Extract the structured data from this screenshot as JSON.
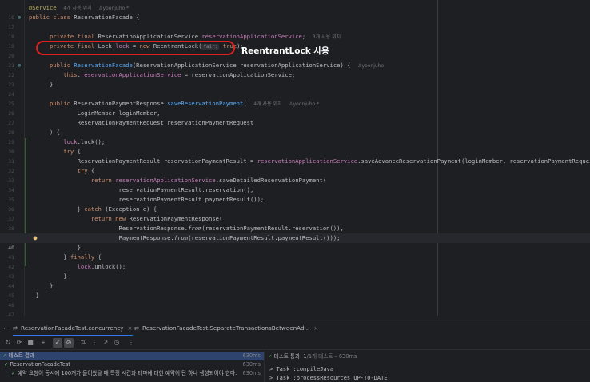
{
  "editor": {
    "annotation_label": "ReentrantLock 사용",
    "lines": [
      {
        "num": "16",
        "current": false
      },
      {
        "num": "17",
        "current": false
      },
      {
        "num": "18",
        "current": false
      },
      {
        "num": "19",
        "current": false
      },
      {
        "num": "20",
        "current": false
      },
      {
        "num": "21",
        "current": false
      },
      {
        "num": "22",
        "current": false
      },
      {
        "num": "23",
        "current": false
      },
      {
        "num": "24",
        "current": false
      },
      {
        "num": "25",
        "current": false
      },
      {
        "num": "26",
        "current": false
      },
      {
        "num": "27",
        "current": false
      },
      {
        "num": "28",
        "current": false
      },
      {
        "num": "29",
        "current": false
      },
      {
        "num": "30",
        "current": false
      },
      {
        "num": "31",
        "current": false
      },
      {
        "num": "32",
        "current": false
      },
      {
        "num": "33",
        "current": false
      },
      {
        "num": "34",
        "current": false
      },
      {
        "num": "35",
        "current": false
      },
      {
        "num": "36",
        "current": false
      },
      {
        "num": "37",
        "current": false
      },
      {
        "num": "38",
        "current": false
      },
      {
        "num": "39",
        "current": false
      },
      {
        "num": "40",
        "current": true
      },
      {
        "num": "41",
        "current": false
      },
      {
        "num": "42",
        "current": false
      },
      {
        "num": "43",
        "current": false
      },
      {
        "num": "44",
        "current": false
      },
      {
        "num": "45",
        "current": false
      },
      {
        "num": "46",
        "current": false
      },
      {
        "num": "47",
        "current": false
      }
    ],
    "hints": {
      "class_usage": "4개 사용 위치",
      "author": "yoonjuho *",
      "author_plain": "yoonjuho",
      "field_usage": "3개 사용 위치",
      "method_usage": "4개 사용 위치",
      "param_fair": "fair:"
    },
    "code": {
      "l16_ann": "@Service",
      "l17_kw": "public class ",
      "l17_cls": "ReservationFacade {",
      "l20_kw": "private final ",
      "l20_type": "ReservationApplicationService ",
      "l20_fld": "reservationApplicationService",
      "l20_end": ";",
      "l21_kw": "private final ",
      "l21_type": "Lock ",
      "l21_fld": "lock",
      "l21_mid": " = ",
      "l21_kw2": "new ",
      "l21_ctor": "ReentrantLock(",
      "l21_val": " true",
      "l21_end": ");",
      "l23_kw": "public ",
      "l23_fn": "ReservationFacade",
      "l23_params": "(ReservationApplicationService reservationApplicationService) {",
      "l24_kw": "this",
      "l24_dot": ".",
      "l24_fld": "reservationApplicationService",
      "l24_rest": " = reservationApplicationService;",
      "l25": "}",
      "l27_kw": "public ",
      "l27_type": "ReservationPaymentResponse ",
      "l27_fn": "saveReservationPayment",
      "l27_paren": "(",
      "l28": "LoginMember loginMember,",
      "l29": "ReservationPaymentRequest reservationPaymentRequest",
      "l30": ") {",
      "l31_fld": "lock",
      "l31_rest": ".lock();",
      "l32_kw": "try",
      "l32_rest": " {",
      "l33_type": "ReservationPaymentResult reservationPaymentResult = ",
      "l33_fld": "reservationApplicationService",
      "l33_rest": ".saveAdvanceReservationPayment(loginMember, reservationPaymentRequest);",
      "l34_kw": "try",
      "l34_rest": " {",
      "l35_kw": "return ",
      "l35_fld": "reservationApplicationService",
      "l35_rest": ".saveDetailedReservationPayment(",
      "l36": "reservationPaymentResult.reservation(),",
      "l37": "reservationPaymentResult.paymentResult());",
      "l38_a": "} ",
      "l38_kw": "catch",
      "l38_rest": " (Exception e) {",
      "l39_kw": "return new ",
      "l39_rest": "ReservationPaymentResponse(",
      "l40_a": "ReservationResponse.",
      "l40_stat": "from",
      "l40_rest": "(reservationPaymentResult.reservation()),",
      "l41_a": "PaymentResponse.",
      "l41_stat": "from",
      "l41_rest": "(reservationPaymentResult.paymentResult()));",
      "l42": "}",
      "l43_a": "} ",
      "l43_kw": "finally",
      "l43_rest": " {",
      "l44_fld": "lock",
      "l44_rest": ".unlock();",
      "l45": "}",
      "l46": "}",
      "l47": "}"
    }
  },
  "tabs": [
    {
      "label": "ReservationFacadeTest.concurrency",
      "active": true
    },
    {
      "label": "ReservationFacadeTest.SeparateTransactionsBetweenAd...",
      "active": false
    }
  ],
  "toolbar": {
    "icons": [
      "rerun-icon",
      "rerun-failed-icon",
      "stop-icon",
      "pin-icon",
      "show-passed-icon",
      "show-ignored-icon",
      "sort-icon",
      "expand-icon",
      "export-icon",
      "history-icon",
      "more-icon"
    ]
  },
  "results": {
    "root_label": "테스트 결과",
    "root_time": "630ms",
    "class_label": "ReservationFacadeTest",
    "class_time": "630ms",
    "test_label": "예약 요청이 동시에 100개가 들어왔을 때 특정 시간과 테마에 대한 예약이 단 하나 생성되어야 한다.",
    "test_time": "630ms"
  },
  "console": {
    "header_pass": "테스트 통과: 1",
    "header_rest": "/1개 테스트 – 630ms",
    "lines": [
      "> Task :compileJava",
      "> Task :processResources UP-TO-DATE"
    ]
  }
}
